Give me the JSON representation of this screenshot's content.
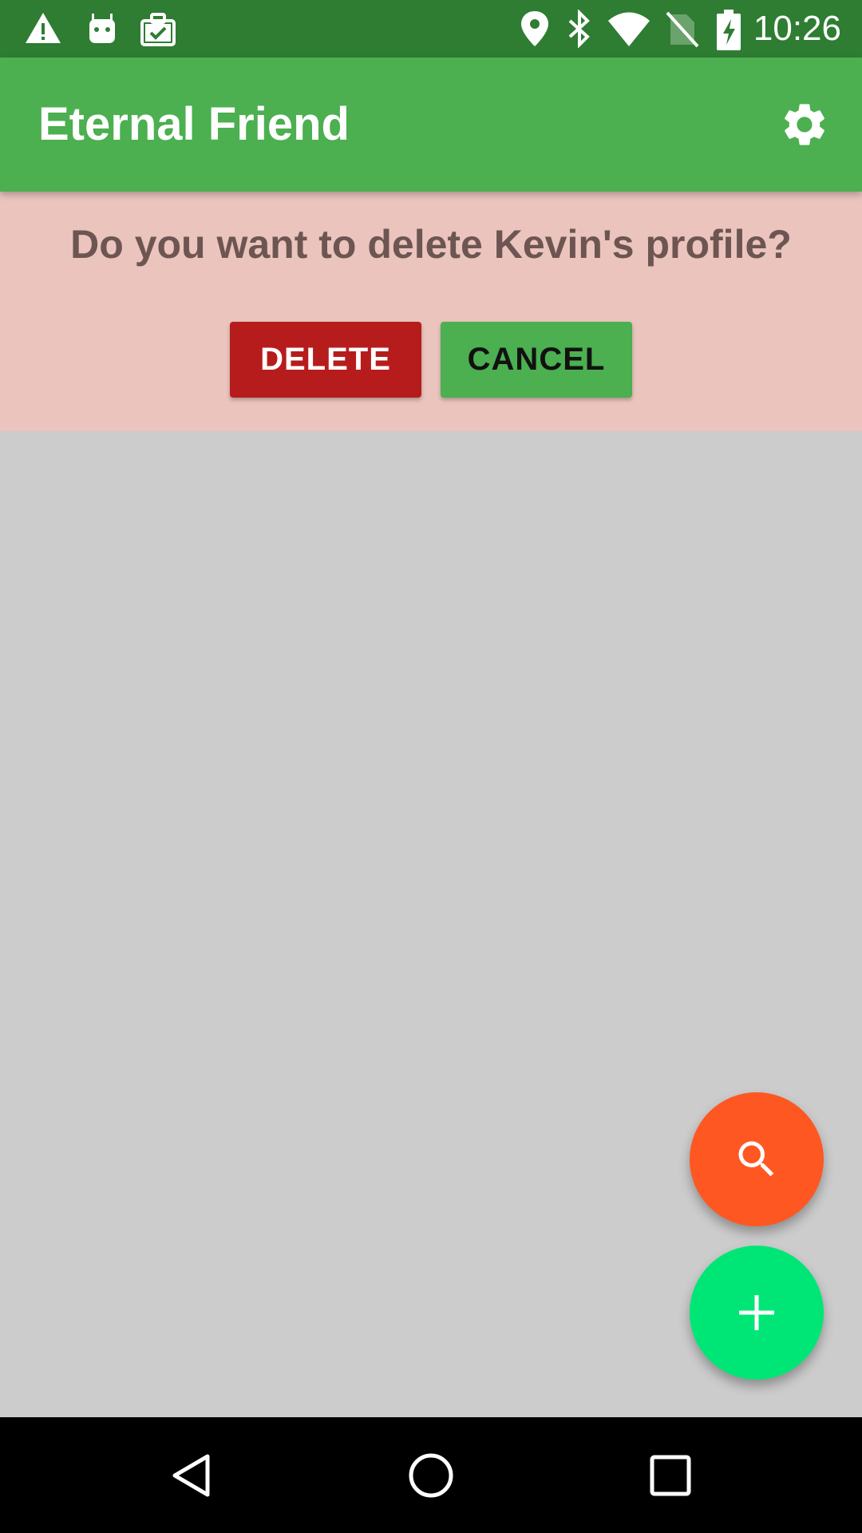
{
  "status_bar": {
    "time": "10:26",
    "left_icons": [
      "warning-icon",
      "android-icon",
      "briefcase-check-icon"
    ],
    "right_icons": [
      "location-icon",
      "bluetooth-icon",
      "wifi-icon",
      "no-sim-icon",
      "battery-charging-icon"
    ]
  },
  "app_bar": {
    "title": "Eternal Friend",
    "action_icon": "gear-icon"
  },
  "confirm_dialog": {
    "message": "Do you want to delete Kevin's profile?",
    "delete_label": "DELETE",
    "cancel_label": "CANCEL"
  },
  "fabs": {
    "search_icon": "search-icon",
    "add_icon": "plus-icon"
  },
  "nav_bar": {
    "icons": [
      "back-icon",
      "home-icon",
      "recents-icon"
    ]
  },
  "colors": {
    "status_bar": "#2e7d32",
    "app_bar": "#4caf50",
    "confirm_panel": "#eac4bd",
    "delete_button": "#b71c1c",
    "cancel_button": "#4caf50",
    "content_background": "#cccccc",
    "search_fab": "#ff5722",
    "add_fab": "#00e676",
    "nav_bar": "#000000"
  }
}
